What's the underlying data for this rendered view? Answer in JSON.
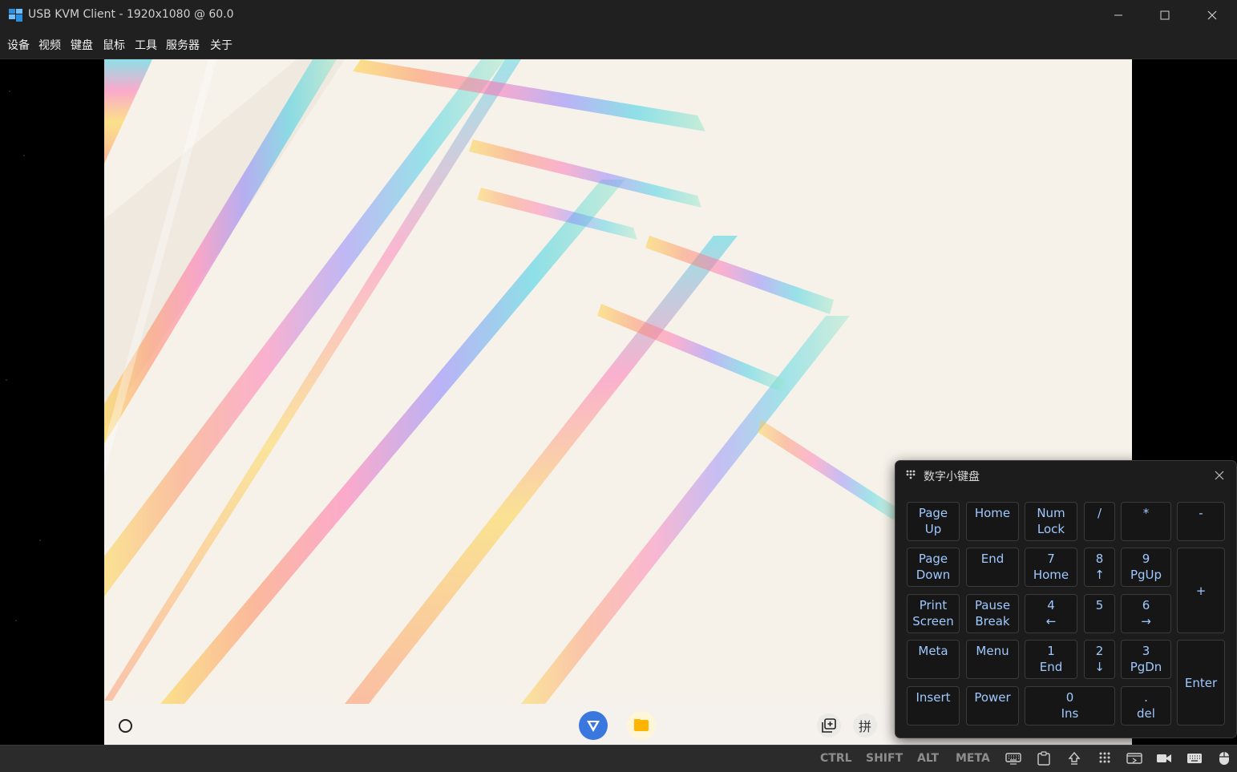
{
  "window": {
    "title": "USB KVM Client - 1920x1080 @ 60.0",
    "controls": [
      "minimize-icon",
      "maximize-icon",
      "close-icon"
    ]
  },
  "menu": [
    "设备",
    "视频",
    "键盘",
    "鼠标",
    "工具",
    "服务器",
    "关于"
  ],
  "keypad": {
    "title": "数字小键盘",
    "keys": [
      {
        "top": "Page",
        "bottom": "Up"
      },
      {
        "top": "Home",
        "bottom": ""
      },
      {
        "top": "Num",
        "bottom": "Lock"
      },
      {
        "top": "/",
        "bottom": ""
      },
      {
        "top": "*",
        "bottom": ""
      },
      {
        "top": "-",
        "bottom": ""
      },
      {
        "top": "Page",
        "bottom": "Down"
      },
      {
        "top": "End",
        "bottom": ""
      },
      {
        "top": "7",
        "bottom": "Home"
      },
      {
        "top": "8",
        "bottom": "↑"
      },
      {
        "top": "9",
        "bottom": "PgUp"
      },
      {
        "top": "+",
        "bottom": ""
      },
      {
        "top": "Print",
        "bottom": "Screen"
      },
      {
        "top": "Pause",
        "bottom": "Break"
      },
      {
        "top": "4",
        "bottom": "←"
      },
      {
        "top": "5",
        "bottom": ""
      },
      {
        "top": "6",
        "bottom": "→"
      },
      {
        "top": "Meta",
        "bottom": ""
      },
      {
        "top": "Menu",
        "bottom": ""
      },
      {
        "top": "1",
        "bottom": "End"
      },
      {
        "top": "2",
        "bottom": "↓"
      },
      {
        "top": "3",
        "bottom": "PgDn"
      },
      {
        "top": "Enter",
        "bottom": ""
      },
      {
        "top": "Insert",
        "bottom": ""
      },
      {
        "top": "Power",
        "bottom": ""
      },
      {
        "top": "0",
        "bottom": "Ins"
      },
      {
        "top": ".",
        "bottom": "del"
      }
    ]
  },
  "statusbar": {
    "modifiers": [
      "CTRL",
      "SHIFT",
      "ALT",
      "META"
    ],
    "icons": [
      "keyboard-icon",
      "clipboard-icon",
      "upload-icon",
      "keypad-icon",
      "screen-icon",
      "camera-icon",
      "keyboard-alt-icon",
      "mouse-icon"
    ]
  },
  "remote": {
    "taskbar_icons": [
      "home-circle-icon",
      "app-launcher-icon",
      "file-manager-icon",
      "multitask-icon",
      "input-method-icon"
    ],
    "input_method_label": "拼"
  },
  "colors": {
    "chrome": "#202020",
    "key_text": "#9fc8ff",
    "statusbar": "#2b2b2b"
  }
}
